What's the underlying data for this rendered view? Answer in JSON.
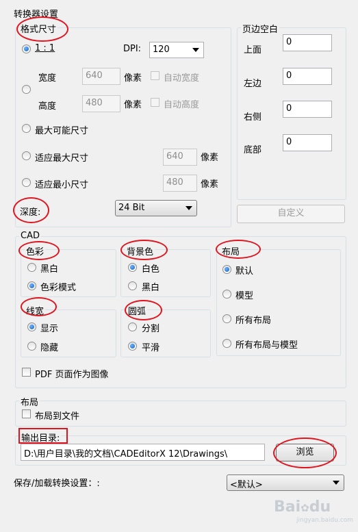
{
  "dialog": {
    "title": "转换器设置",
    "format_size": {
      "legend": "格式尺寸",
      "option_1to1": "1 : 1",
      "dpi_label": "DPI:",
      "dpi_value": "120",
      "width_label": "宽度",
      "width_value": "640",
      "height_label": "高度",
      "height_value": "480",
      "pixels_label": "像素",
      "auto_width": "自动宽度",
      "auto_height": "自动高度",
      "max_possible": "最大可能尺寸",
      "fit_max": "适应最大尺寸",
      "fit_max_value": "640",
      "fit_min": "适应最小尺寸",
      "fit_min_value": "480",
      "depth_label": "深度:",
      "depth_value": "24 Bit"
    },
    "margins": {
      "legend": "页边空白",
      "top_label": "上面",
      "top_value": "0",
      "left_label": "左边",
      "left_value": "0",
      "right_label": "右侧",
      "right_value": "0",
      "bottom_label": "底部",
      "bottom_value": "0",
      "custom_button": "自定义"
    },
    "cad": {
      "legend": "CAD",
      "color": {
        "legend": "色彩",
        "bw": "黑白",
        "color_mode": "色彩模式"
      },
      "background": {
        "legend": "背景色",
        "white": "白色",
        "black": "黑白"
      },
      "layout": {
        "legend": "布局",
        "default": "默认",
        "model": "模型",
        "all_layouts": "所有布局",
        "all_layouts_model": "所有布局与模型"
      },
      "linewidth": {
        "legend": "线宽",
        "show": "显示",
        "hide": "隐藏"
      },
      "arc": {
        "legend": "圆弧",
        "split": "分割",
        "smooth": "平滑"
      },
      "pdf_as_image": "PDF 页面作为图像"
    },
    "layout_section": {
      "legend": "布局",
      "layout_to_file": "布局到文件"
    },
    "output": {
      "label": "输出目录:",
      "path": "D:\\用户目录\\我的文档\\CADEditorX 12\\Drawings\\",
      "browse_button": "浏览"
    },
    "save_load": {
      "label": "保存/加载转换设置：:",
      "value": "<默认>"
    }
  },
  "watermark": {
    "brand": "Bai",
    "paw": "du",
    "sub": "jingyan.baidu.com"
  },
  "colors": {
    "annotation": "#e0141e",
    "radio_dot": "#1565c0",
    "background": "#f0f0f0"
  },
  "icons": [
    "dropdown-arrow-icon",
    "radio-icon",
    "checkbox-icon"
  ]
}
